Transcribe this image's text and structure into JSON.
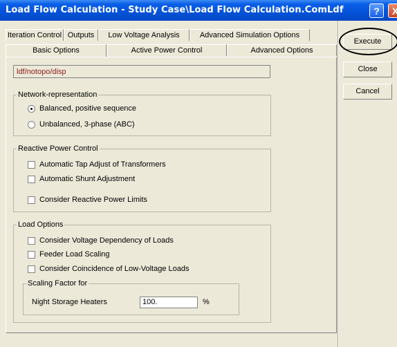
{
  "window": {
    "title": "Load Flow Calculation - Study Case\\Load Flow Calculation.ComLdf"
  },
  "titlebar_buttons": {
    "help": "?",
    "close": "X"
  },
  "tabs": {
    "row1": [
      "Iteration Control",
      "Outputs",
      "Low Voltage Analysis",
      "Advanced Simulation Options"
    ],
    "row2": [
      "Basic Options",
      "Active Power Control",
      "Advanced Options"
    ],
    "active": "Basic Options"
  },
  "path": "ldf/notopo/disp",
  "network": {
    "legend": "Network-representation",
    "options": [
      {
        "label": "Balanced, positive sequence",
        "selected": true
      },
      {
        "label": "Unbalanced, 3-phase (ABC)",
        "selected": false
      }
    ]
  },
  "reactive": {
    "legend": "Reactive Power Control",
    "items": [
      "Automatic Tap Adjust of Transformers",
      "Automatic Shunt Adjustment",
      "Consider Reactive Power Limits"
    ]
  },
  "load": {
    "legend": "Load Options",
    "items": [
      "Consider Voltage Dependency of Loads",
      "Feeder Load Scaling",
      "Consider Coincidence of Low-Voltage Loads"
    ],
    "scaling": {
      "legend": "Scaling Factor for",
      "label": "Night Storage Heaters",
      "value": "100.",
      "unit": "%"
    }
  },
  "buttons": {
    "execute": "Execute",
    "close": "Close",
    "cancel": "Cancel"
  }
}
